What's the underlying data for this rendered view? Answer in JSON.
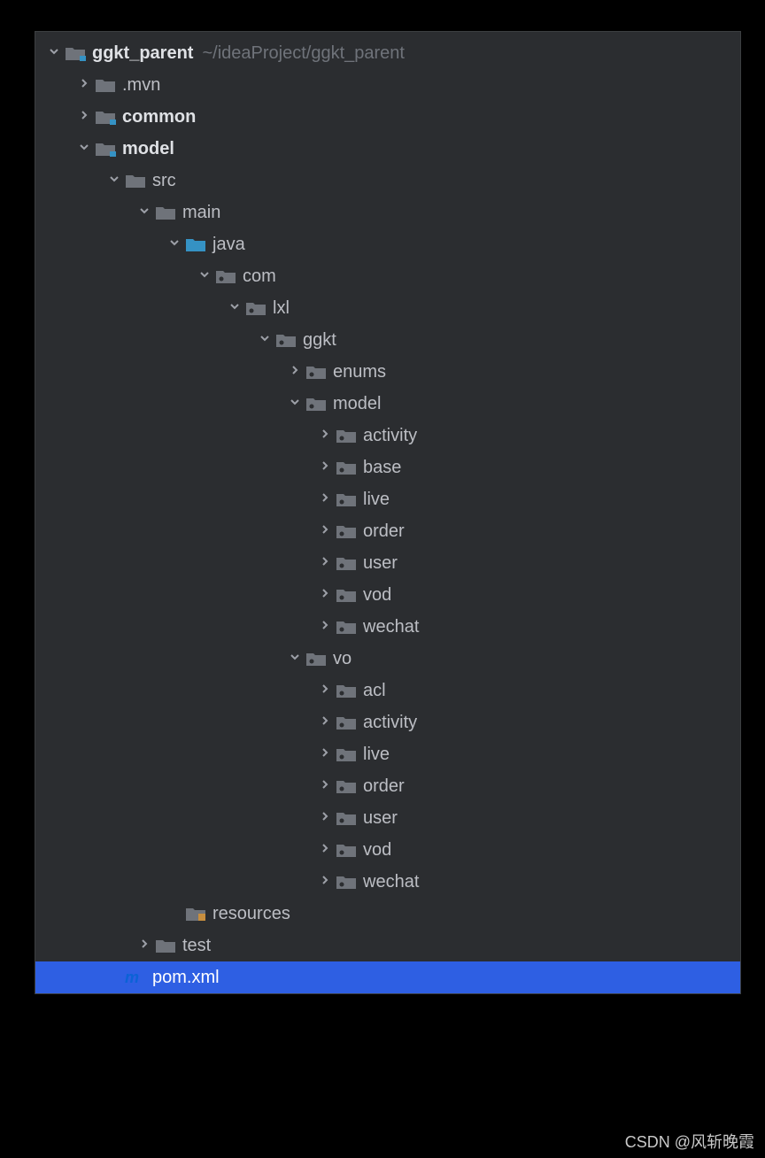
{
  "root": {
    "label": "ggkt_parent",
    "hint": "~/ideaProject/ggkt_parent"
  },
  "mvn": {
    "label": ".mvn"
  },
  "common": {
    "label": "common"
  },
  "model": {
    "label": "model"
  },
  "src": {
    "label": "src"
  },
  "main": {
    "label": "main"
  },
  "java": {
    "label": "java"
  },
  "com": {
    "label": "com"
  },
  "lxl": {
    "label": "lxl"
  },
  "ggkt": {
    "label": "ggkt"
  },
  "enums": {
    "label": "enums"
  },
  "modelpkg": {
    "label": "model"
  },
  "m_activity": {
    "label": "activity"
  },
  "m_base": {
    "label": "base"
  },
  "m_live": {
    "label": "live"
  },
  "m_order": {
    "label": "order"
  },
  "m_user": {
    "label": "user"
  },
  "m_vod": {
    "label": "vod"
  },
  "m_wechat": {
    "label": "wechat"
  },
  "vo": {
    "label": "vo"
  },
  "v_acl": {
    "label": "acl"
  },
  "v_activity": {
    "label": "activity"
  },
  "v_live": {
    "label": "live"
  },
  "v_order": {
    "label": "order"
  },
  "v_user": {
    "label": "user"
  },
  "v_vod": {
    "label": "vod"
  },
  "v_wechat": {
    "label": "wechat"
  },
  "resources": {
    "label": "resources"
  },
  "test": {
    "label": "test"
  },
  "pom": {
    "label": "pom.xml"
  },
  "watermark": "CSDN @风斩晚霞"
}
